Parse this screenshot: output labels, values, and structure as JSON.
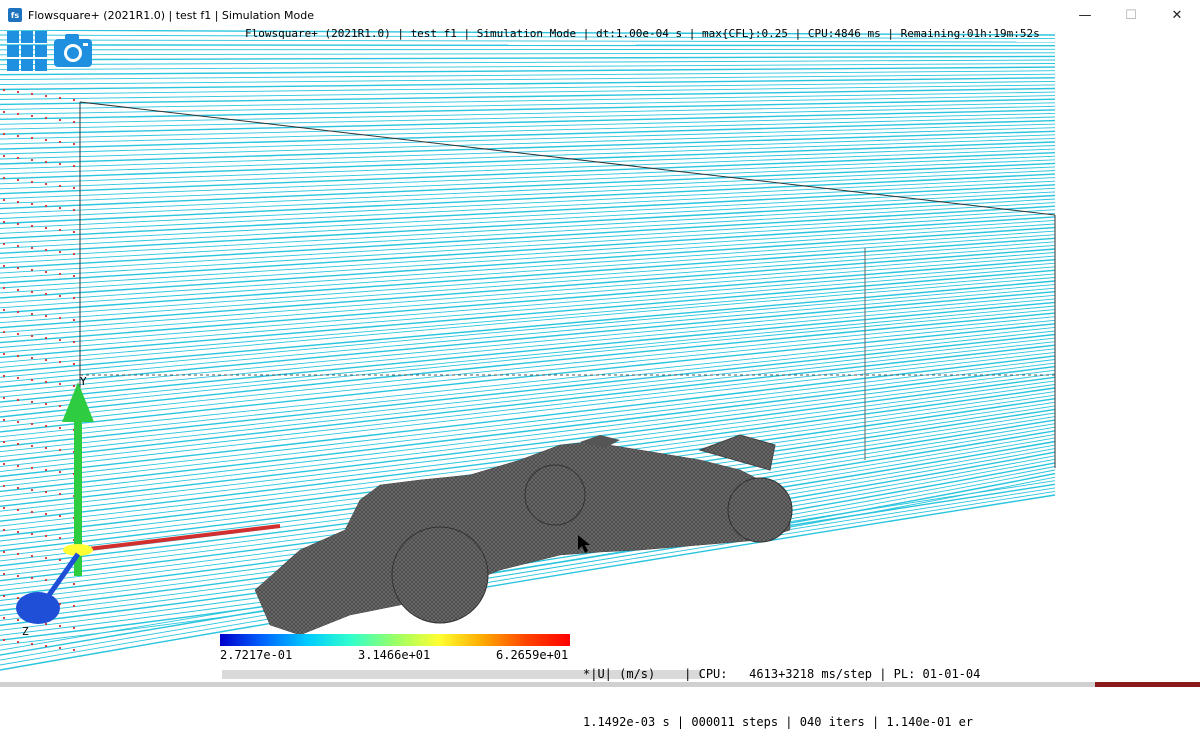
{
  "window": {
    "title": "Flowsquare+ (2021R1.0) | test f1 | Simulation Mode",
    "icon_text": "fs",
    "controls": {
      "minimize": "—",
      "maximize": "☐",
      "close": "✕"
    }
  },
  "toolbar": {
    "apps_icon": "grid-icon",
    "camera_icon": "camera-icon"
  },
  "status_top": "Flowsquare+ (2021R1.0) | test f1 | Simulation Mode | dt:1.00e-04 s | max{CFL}:0.25 | CPU:4846 ms | Remaining:01h:19m:52s",
  "legend": {
    "min": "2.7217e-01",
    "mid": "3.1466e+01",
    "max": "6.2659e+01"
  },
  "status_bottom": {
    "line1": "*|U| (m/s)    | CPU:   4613+3218 ms/step | PL: 01-01-04",
    "line2": "1.1492e-03 s | 000011 steps | 040 iters | 1.140e-01 er"
  },
  "axes": {
    "y": "Y",
    "z": "Z"
  },
  "colors": {
    "streamline": "#29c5de",
    "mesh": "#5a5a5a",
    "axis_y": "#2ecc40",
    "axis_x": "#d32f2f",
    "axis_z": "#1f4fd6",
    "accent_blue": "#1f8fdf"
  }
}
